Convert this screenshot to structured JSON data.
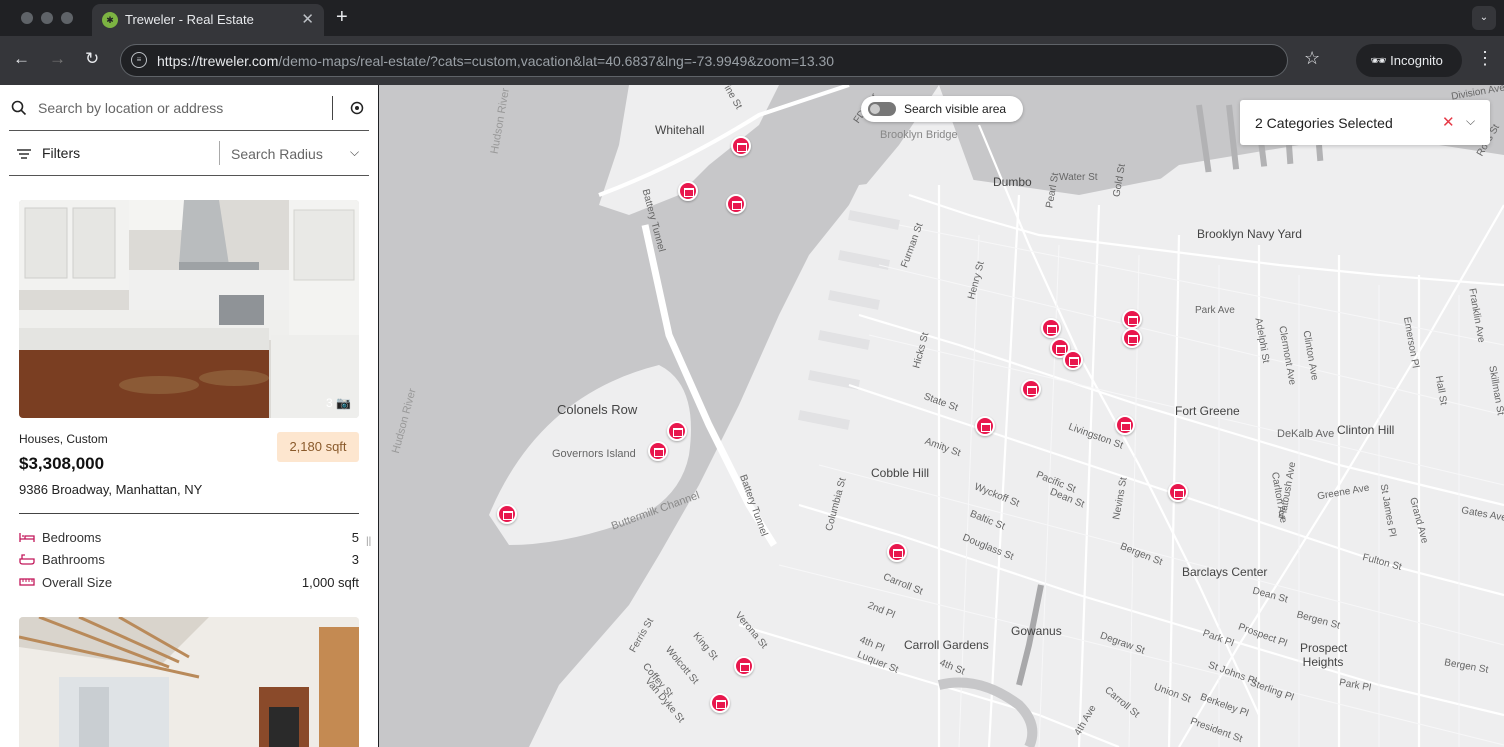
{
  "browser": {
    "tab_title": "Treweler - Real Estate",
    "tab_close": "✕",
    "new_tab": "+",
    "url_host": "https://treweler.com",
    "url_path": "/demo-maps/real-estate/?cats=custom,vacation&lat=40.6837&lng=-73.9949&zoom=13.30",
    "incognito_label": "Incognito"
  },
  "sidebar": {
    "search_placeholder": "Search by location or address",
    "filters_label": "Filters",
    "radius_placeholder": "Search Radius",
    "listing": {
      "categories": "Houses, Custom",
      "price": "$3,308,000",
      "address": "9386 Broadway, Manhattan, NY",
      "area_badge": "2,180 sqft",
      "photo_count": "3",
      "specs": [
        {
          "label": "Bedrooms",
          "value": "5",
          "icon": "bed-icon"
        },
        {
          "label": "Bathrooms",
          "value": "3",
          "icon": "bath-icon"
        },
        {
          "label": "Overall Size",
          "value": "1,000 sqft",
          "icon": "ruler-icon"
        }
      ]
    }
  },
  "map": {
    "search_visible_label": "Search visible area",
    "categories_selected": "2 Categories Selected",
    "labels": [
      "Whitehall",
      "Brooklyn Bridge",
      "Dumbo",
      "Water St",
      "Brooklyn Navy Yard",
      "Park Ave",
      "Colonels Row",
      "Governors Island",
      "Buttermilk Channel",
      "Fort Greene",
      "Clinton Hill",
      "DeKalb Ave",
      "Cobble Hill",
      "State St",
      "Livingston St",
      "Barclays Center",
      "Gowanus",
      "Carroll Gardens",
      "Prospect Heights",
      "Hudson River",
      "Hudson River",
      "Battery Tunnel",
      "Battery Tunnel",
      "FDR Dr",
      "Division Ave",
      "Furman St",
      "Hicks St",
      "Henry St",
      "Amity St",
      "Columbia St",
      "Pacific St",
      "Dean St",
      "Wyckoff St",
      "Baltic St",
      "Douglass St",
      "Bergen St",
      "Carroll St",
      "2nd Pl",
      "4th Pl",
      "Luquer St",
      "4th St",
      "Ferris St",
      "King St",
      "Wolcott St",
      "Coffey St",
      "Van Dyke St",
      "Verona St",
      "Nevins St",
      "Flatbush Ave",
      "Greene Ave",
      "Fulton St",
      "Dean St",
      "Bergen St",
      "Park Pl",
      "Prospect Pl",
      "St Johns Pl",
      "Sterling Pl",
      "Berkeley Pl",
      "Union St",
      "President St",
      "Degraw St",
      "Carroll St",
      "4th Ave",
      "Park Pl",
      "Bergen St",
      "Gates Ave",
      "St James Pl",
      "Grand Ave",
      "Carlton Ave",
      "Adelphi St",
      "Clermont Ave",
      "Clinton Ave",
      "Emerson Pl",
      "Hall St",
      "Franklin Ave",
      "Skillman St",
      "Gold St",
      "Pearl St",
      "Ross St",
      "Pine St"
    ]
  },
  "colors": {
    "pin": "#e8174d",
    "badge_bg": "#fde6cf",
    "clear_x": "#e63946"
  }
}
